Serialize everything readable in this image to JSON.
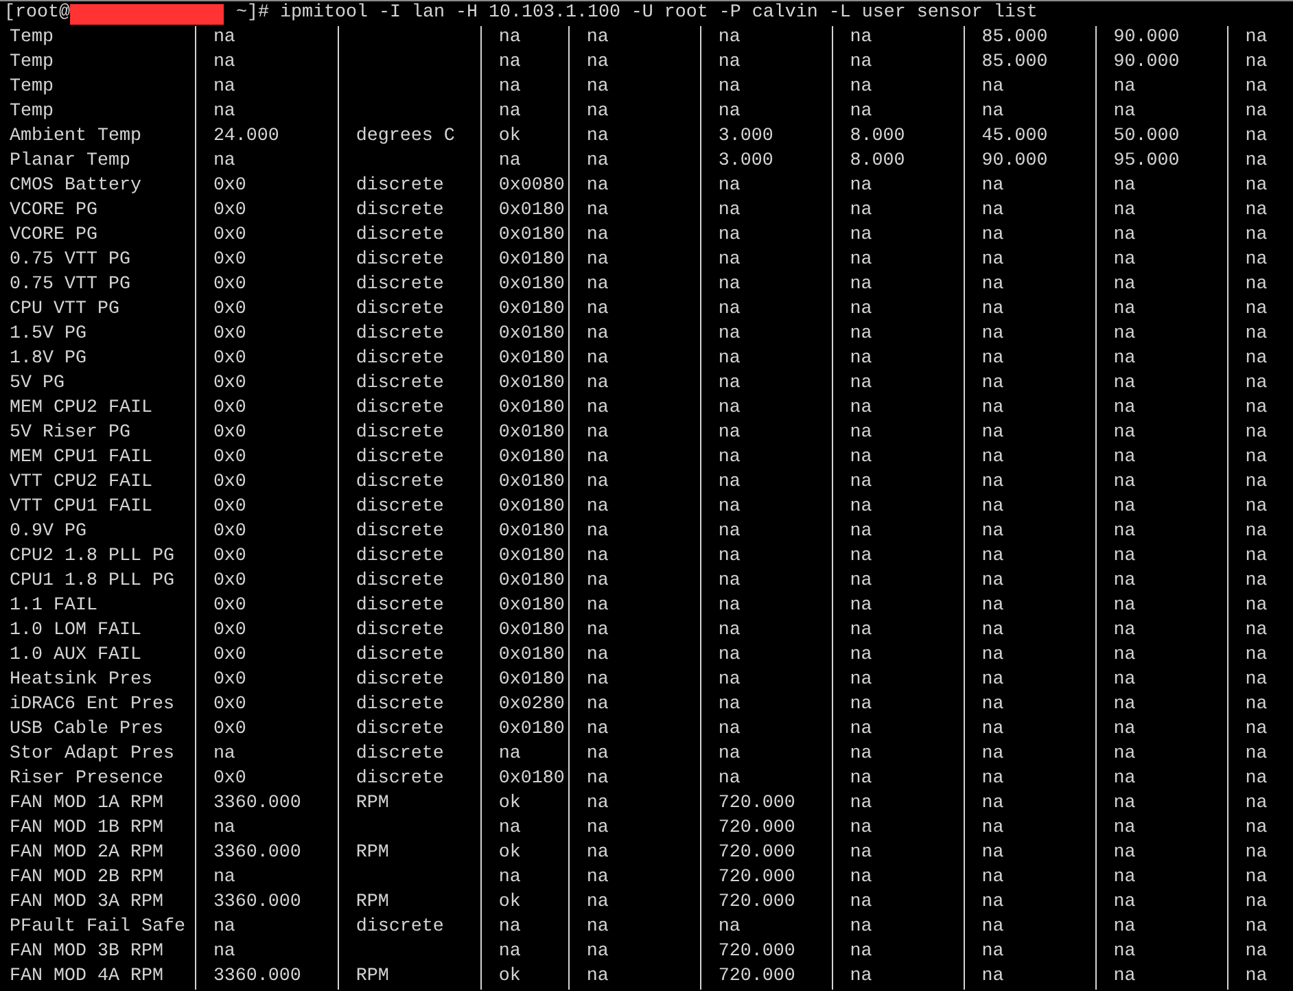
{
  "prompt": {
    "user": "[root@",
    "redacted": true,
    "command": "~]# ipmitool -I lan -H 10.103.1.100 -U root -P calvin -L user sensor list"
  },
  "rows": [
    {
      "column_1": "Temp",
      "column_2": "na",
      "column_4": "na",
      "column_5": "na",
      "column_6": "na",
      "column_7": "na",
      "column_8": "85.000",
      "column_9": "90.000",
      "column_10": "na"
    },
    {
      "column_1": "Temp",
      "column_2": "na",
      "column_4": "na",
      "column_5": "na",
      "column_6": "na",
      "column_7": "na",
      "column_8": "85.000",
      "column_9": "90.000",
      "column_10": "na"
    },
    {
      "column_1": "Temp",
      "column_2": "na",
      "column_4": "na",
      "column_5": "na",
      "column_6": "na",
      "column_7": "na",
      "column_8": "na",
      "column_9": "na",
      "column_10": "na"
    },
    {
      "column_1": "Temp",
      "column_2": "na",
      "column_4": "na",
      "column_5": "na",
      "column_6": "na",
      "column_7": "na",
      "column_8": "na",
      "column_9": "na",
      "column_10": "na"
    },
    {
      "column_1": "Ambient Temp",
      "column_2": "24.000",
      "column_3": "degrees C",
      "column_4": "ok",
      "column_5": "na",
      "column_6": "3.000",
      "column_7": "8.000",
      "column_8": "45.000",
      "column_9": "50.000",
      "column_10": "na"
    },
    {
      "column_1": "Planar Temp",
      "column_2": "na",
      "column_4": "na",
      "column_5": "na",
      "column_6": "3.000",
      "column_7": "8.000",
      "column_8": "90.000",
      "column_9": "95.000",
      "column_10": "na"
    },
    {
      "column_1": "CMOS Battery",
      "column_2": "0x0",
      "column_3": "discrete",
      "column_4": "0x0080",
      "column_5": "na",
      "column_6": "na",
      "column_7": "na",
      "column_8": "na",
      "column_9": "na",
      "column_10": "na"
    },
    {
      "column_1": "VCORE PG",
      "column_2": "0x0",
      "column_3": "discrete",
      "column_4": "0x0180",
      "column_5": "na",
      "column_6": "na",
      "column_7": "na",
      "column_8": "na",
      "column_9": "na",
      "column_10": "na"
    },
    {
      "column_1": "VCORE PG",
      "column_2": "0x0",
      "column_3": "discrete",
      "column_4": "0x0180",
      "column_5": "na",
      "column_6": "na",
      "column_7": "na",
      "column_8": "na",
      "column_9": "na",
      "column_10": "na"
    },
    {
      "column_1": "0.75 VTT PG",
      "column_2": "0x0",
      "column_3": "discrete",
      "column_4": "0x0180",
      "column_5": "na",
      "column_6": "na",
      "column_7": "na",
      "column_8": "na",
      "column_9": "na",
      "column_10": "na"
    },
    {
      "column_1": "0.75 VTT PG",
      "column_2": "0x0",
      "column_3": "discrete",
      "column_4": "0x0180",
      "column_5": "na",
      "column_6": "na",
      "column_7": "na",
      "column_8": "na",
      "column_9": "na",
      "column_10": "na"
    },
    {
      "column_1": "CPU VTT PG",
      "column_2": "0x0",
      "column_3": "discrete",
      "column_4": "0x0180",
      "column_5": "na",
      "column_6": "na",
      "column_7": "na",
      "column_8": "na",
      "column_9": "na",
      "column_10": "na"
    },
    {
      "column_1": "1.5V PG",
      "column_2": "0x0",
      "column_3": "discrete",
      "column_4": "0x0180",
      "column_5": "na",
      "column_6": "na",
      "column_7": "na",
      "column_8": "na",
      "column_9": "na",
      "column_10": "na"
    },
    {
      "column_1": "1.8V PG",
      "column_2": "0x0",
      "column_3": "discrete",
      "column_4": "0x0180",
      "column_5": "na",
      "column_6": "na",
      "column_7": "na",
      "column_8": "na",
      "column_9": "na",
      "column_10": "na"
    },
    {
      "column_1": "5V PG",
      "column_2": "0x0",
      "column_3": "discrete",
      "column_4": "0x0180",
      "column_5": "na",
      "column_6": "na",
      "column_7": "na",
      "column_8": "na",
      "column_9": "na",
      "column_10": "na"
    },
    {
      "column_1": "MEM CPU2 FAIL",
      "column_2": "0x0",
      "column_3": "discrete",
      "column_4": "0x0180",
      "column_5": "na",
      "column_6": "na",
      "column_7": "na",
      "column_8": "na",
      "column_9": "na",
      "column_10": "na"
    },
    {
      "column_1": "5V Riser PG",
      "column_2": "0x0",
      "column_3": "discrete",
      "column_4": "0x0180",
      "column_5": "na",
      "column_6": "na",
      "column_7": "na",
      "column_8": "na",
      "column_9": "na",
      "column_10": "na"
    },
    {
      "column_1": "MEM CPU1 FAIL",
      "column_2": "0x0",
      "column_3": "discrete",
      "column_4": "0x0180",
      "column_5": "na",
      "column_6": "na",
      "column_7": "na",
      "column_8": "na",
      "column_9": "na",
      "column_10": "na"
    },
    {
      "column_1": "VTT CPU2 FAIL",
      "column_2": "0x0",
      "column_3": "discrete",
      "column_4": "0x0180",
      "column_5": "na",
      "column_6": "na",
      "column_7": "na",
      "column_8": "na",
      "column_9": "na",
      "column_10": "na"
    },
    {
      "column_1": "VTT CPU1 FAIL",
      "column_2": "0x0",
      "column_3": "discrete",
      "column_4": "0x0180",
      "column_5": "na",
      "column_6": "na",
      "column_7": "na",
      "column_8": "na",
      "column_9": "na",
      "column_10": "na"
    },
    {
      "column_1": "0.9V PG",
      "column_2": "0x0",
      "column_3": "discrete",
      "column_4": "0x0180",
      "column_5": "na",
      "column_6": "na",
      "column_7": "na",
      "column_8": "na",
      "column_9": "na",
      "column_10": "na"
    },
    {
      "column_1": "CPU2 1.8 PLL PG",
      "column_2": "0x0",
      "column_3": "discrete",
      "column_4": "0x0180",
      "column_5": "na",
      "column_6": "na",
      "column_7": "na",
      "column_8": "na",
      "column_9": "na",
      "column_10": "na"
    },
    {
      "column_1": "CPU1 1.8 PLL PG",
      "column_2": "0x0",
      "column_3": "discrete",
      "column_4": "0x0180",
      "column_5": "na",
      "column_6": "na",
      "column_7": "na",
      "column_8": "na",
      "column_9": "na",
      "column_10": "na"
    },
    {
      "column_1": "1.1 FAIL",
      "column_2": "0x0",
      "column_3": "discrete",
      "column_4": "0x0180",
      "column_5": "na",
      "column_6": "na",
      "column_7": "na",
      "column_8": "na",
      "column_9": "na",
      "column_10": "na"
    },
    {
      "column_1": "1.0 LOM FAIL",
      "column_2": "0x0",
      "column_3": "discrete",
      "column_4": "0x0180",
      "column_5": "na",
      "column_6": "na",
      "column_7": "na",
      "column_8": "na",
      "column_9": "na",
      "column_10": "na"
    },
    {
      "column_1": "1.0 AUX FAIL",
      "column_2": "0x0",
      "column_3": "discrete",
      "column_4": "0x0180",
      "column_5": "na",
      "column_6": "na",
      "column_7": "na",
      "column_8": "na",
      "column_9": "na",
      "column_10": "na"
    },
    {
      "column_1": "Heatsink Pres",
      "column_2": "0x0",
      "column_3": "discrete",
      "column_4": "0x0180",
      "column_5": "na",
      "column_6": "na",
      "column_7": "na",
      "column_8": "na",
      "column_9": "na",
      "column_10": "na"
    },
    {
      "column_1": "iDRAC6 Ent Pres",
      "column_2": "0x0",
      "column_3": "discrete",
      "column_4": "0x0280",
      "column_5": "na",
      "column_6": "na",
      "column_7": "na",
      "column_8": "na",
      "column_9": "na",
      "column_10": "na"
    },
    {
      "column_1": "USB Cable Pres",
      "column_2": "0x0",
      "column_3": "discrete",
      "column_4": "0x0180",
      "column_5": "na",
      "column_6": "na",
      "column_7": "na",
      "column_8": "na",
      "column_9": "na",
      "column_10": "na"
    },
    {
      "column_1": "Stor Adapt Pres",
      "column_2": "na",
      "column_3": "discrete",
      "column_4": "na",
      "column_5": "na",
      "column_6": "na",
      "column_7": "na",
      "column_8": "na",
      "column_9": "na",
      "column_10": "na"
    },
    {
      "column_1": "Riser Presence",
      "column_2": "0x0",
      "column_3": "discrete",
      "column_4": "0x0180",
      "column_5": "na",
      "column_6": "na",
      "column_7": "na",
      "column_8": "na",
      "column_9": "na",
      "column_10": "na"
    },
    {
      "column_1": "FAN MOD 1A RPM",
      "column_2": "3360.000",
      "column_3": "RPM",
      "column_4": "ok",
      "column_5": "na",
      "column_6": "720.000",
      "column_7": "na",
      "column_8": "na",
      "column_9": "na",
      "column_10": "na"
    },
    {
      "column_1": "FAN MOD 1B RPM",
      "column_2": "na",
      "column_4": "na",
      "column_5": "na",
      "column_6": "720.000",
      "column_7": "na",
      "column_8": "na",
      "column_9": "na",
      "column_10": "na"
    },
    {
      "column_1": "FAN MOD 2A RPM",
      "column_2": "3360.000",
      "column_3": "RPM",
      "column_4": "ok",
      "column_5": "na",
      "column_6": "720.000",
      "column_7": "na",
      "column_8": "na",
      "column_9": "na",
      "column_10": "na"
    },
    {
      "column_1": "FAN MOD 2B RPM",
      "column_2": "na",
      "column_4": "na",
      "column_5": "na",
      "column_6": "720.000",
      "column_7": "na",
      "column_8": "na",
      "column_9": "na",
      "column_10": "na"
    },
    {
      "column_1": "FAN MOD 3A RPM",
      "column_2": "3360.000",
      "column_3": "RPM",
      "column_4": "ok",
      "column_5": "na",
      "column_6": "720.000",
      "column_7": "na",
      "column_8": "na",
      "column_9": "na",
      "column_10": "na"
    },
    {
      "column_1": "PFault Fail Safe",
      "column_2": "na",
      "column_3": "discrete",
      "column_4": "na",
      "column_5": "na",
      "column_6": "na",
      "column_7": "na",
      "column_8": "na",
      "column_9": "na",
      "column_10": "na"
    },
    {
      "column_1": "FAN MOD 3B RPM",
      "column_2": "na",
      "column_4": "na",
      "column_5": "na",
      "column_6": "720.000",
      "column_7": "na",
      "column_8": "na",
      "column_9": "na",
      "column_10": "na"
    },
    {
      "column_1": "FAN MOD 4A RPM",
      "column_2": "3360.000",
      "column_3": "RPM",
      "column_4": "ok",
      "column_5": "na",
      "column_6": "720.000",
      "column_7": "na",
      "column_8": "na",
      "column_9": "na",
      "column_10": "na"
    }
  ]
}
